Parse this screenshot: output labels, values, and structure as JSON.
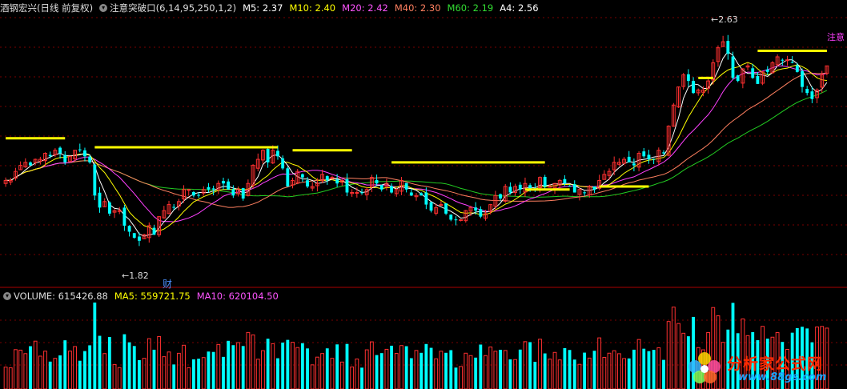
{
  "header": {
    "stock_name": "酒钢宏兴(日线 前复权)",
    "indicator": "注意突破口(6,14,95,250,1,2)",
    "ma_labels": [
      {
        "text": "M5: 2.37",
        "color": "#ffffff"
      },
      {
        "text": "M10: 2.40",
        "color": "#ffff00"
      },
      {
        "text": "M20: 2.42",
        "color": "#ff55ff"
      },
      {
        "text": "M40: 2.30",
        "color": "#ff8060"
      },
      {
        "text": "M60: 2.19",
        "color": "#33dd33"
      },
      {
        "text": "A4: 2.56",
        "color": "#ffffff"
      }
    ]
  },
  "volume_header": {
    "label": "VOLUME: 615426.88",
    "ma5": "MA5: 559721.75",
    "ma10": "MA10: 620104.50"
  },
  "annotations": {
    "high_label": "2.63",
    "low_label": "1.82",
    "attention_label": "注意",
    "finance_mark": "财"
  },
  "watermark": {
    "brand": "分析家公式网",
    "url": "www.88gs.com"
  },
  "colors": {
    "up": "#ff3030",
    "down": "#00ffff",
    "ma5": "#ffffff",
    "ma10": "#ffff00",
    "ma20": "#ff40ff",
    "ma40": "#ff8060",
    "ma60": "#22cc22",
    "signal": "#ffff00"
  },
  "chart_data": {
    "type": "candlestick",
    "price_range": [
      1.82,
      2.63
    ],
    "closes": [
      2.12,
      2.12,
      2.15,
      2.17,
      2.18,
      2.17,
      2.19,
      2.19,
      2.21,
      2.2,
      2.22,
      2.21,
      2.18,
      2.2,
      2.22,
      2.22,
      2.2,
      2.18,
      2.07,
      2.03,
      2.05,
      2.01,
      2.02,
      2.02,
      1.97,
      1.95,
      1.93,
      1.92,
      1.94,
      1.97,
      1.94,
      2.0,
      2.02,
      2.04,
      2.03,
      2.05,
      2.09,
      2.09,
      2.07,
      2.07,
      2.09,
      2.09,
      2.09,
      2.11,
      2.11,
      2.09,
      2.07,
      2.09,
      2.06,
      2.11,
      2.17,
      2.19,
      2.22,
      2.18,
      2.22,
      2.2,
      2.16,
      2.1,
      2.12,
      2.15,
      2.13,
      2.1,
      2.1,
      2.11,
      2.14,
      2.12,
      2.13,
      2.11,
      2.12,
      2.08,
      2.08,
      2.08,
      2.08,
      2.09,
      2.13,
      2.11,
      2.09,
      2.11,
      2.08,
      2.09,
      2.12,
      2.09,
      2.07,
      2.07,
      2.07,
      2.04,
      2.02,
      2.03,
      2.04,
      2.01,
      1.99,
      1.99,
      1.99,
      2.02,
      2.03,
      2.02,
      2.0,
      2.01,
      2.04,
      2.07,
      2.06,
      2.1,
      2.08,
      2.1,
      2.09,
      2.11,
      2.09,
      2.09,
      2.13,
      2.1,
      2.1,
      2.11,
      2.12,
      2.11,
      2.1,
      2.08,
      2.09,
      2.08,
      2.1,
      2.09,
      2.12,
      2.14,
      2.15,
      2.18,
      2.18,
      2.19,
      2.18,
      2.17,
      2.21,
      2.2,
      2.19,
      2.19,
      2.22,
      2.21,
      2.3,
      2.37,
      2.43,
      2.47,
      2.45,
      2.41,
      2.42,
      2.42,
      2.45,
      2.51,
      2.56,
      2.58,
      2.54,
      2.46,
      2.45,
      2.49,
      2.5,
      2.46,
      2.44,
      2.48,
      2.48,
      2.51,
      2.53,
      2.52,
      2.52,
      2.51,
      2.48,
      2.43,
      2.41,
      2.39,
      2.42,
      2.47,
      2.5
    ],
    "volume_range": [
      0,
      1100000
    ],
    "current_values": {
      "M5": 2.37,
      "M10": 2.4,
      "M20": 2.42,
      "M40": 2.3,
      "M60": 2.19,
      "A4": 2.56,
      "VOLUME": 615426.88,
      "MA5": 559721.75,
      "MA10": 620104.5
    }
  }
}
